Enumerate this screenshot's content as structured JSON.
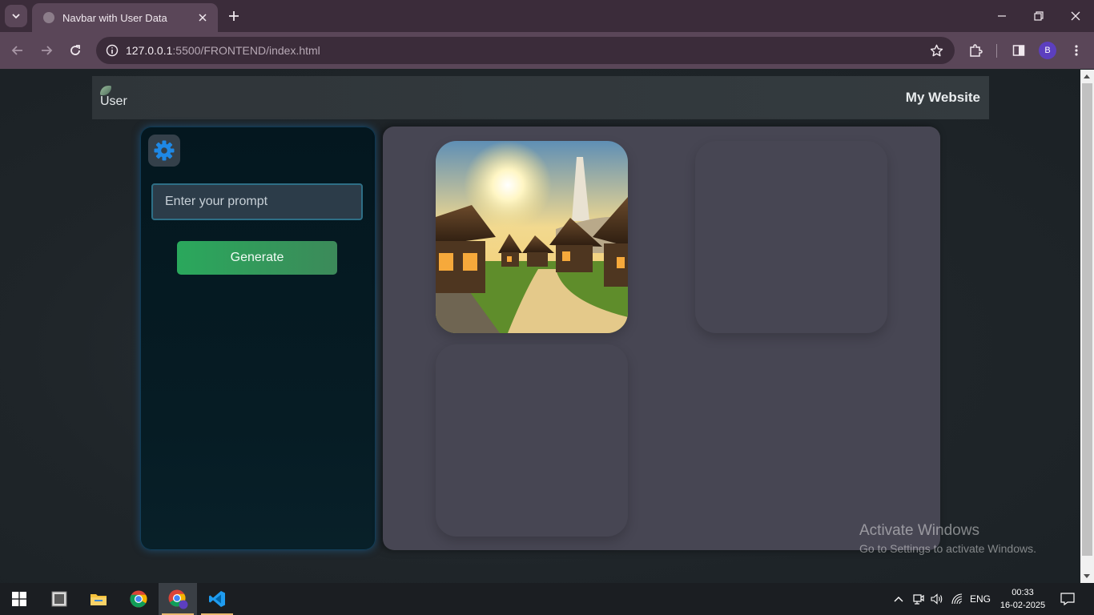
{
  "browser": {
    "tab_title": "Navbar with User Data",
    "url_host": "127.0.0.1",
    "url_path": ":5500/FRONTEND/index.html",
    "profile_initial": "B"
  },
  "page": {
    "navbar": {
      "user_image_alt": "User",
      "brand": "My Website"
    },
    "sidebar": {
      "prompt_placeholder": "Enter your prompt",
      "prompt_value": "",
      "generate_label": "Generate"
    },
    "gallery": {
      "images": [
        {
          "description": "fantasy village with thatched huts at sunrise"
        },
        {
          "description": ""
        },
        {
          "description": ""
        }
      ]
    }
  },
  "watermark": {
    "title": "Activate Windows",
    "subtitle": "Go to Settings to activate Windows."
  },
  "taskbar": {
    "language": "ENG",
    "time": "00:33",
    "date": "16-02-2025"
  },
  "colors": {
    "accent_green": "#2aa85c",
    "gear_blue": "#1e88e5",
    "sidebar_glow": "#1e6eaa"
  }
}
